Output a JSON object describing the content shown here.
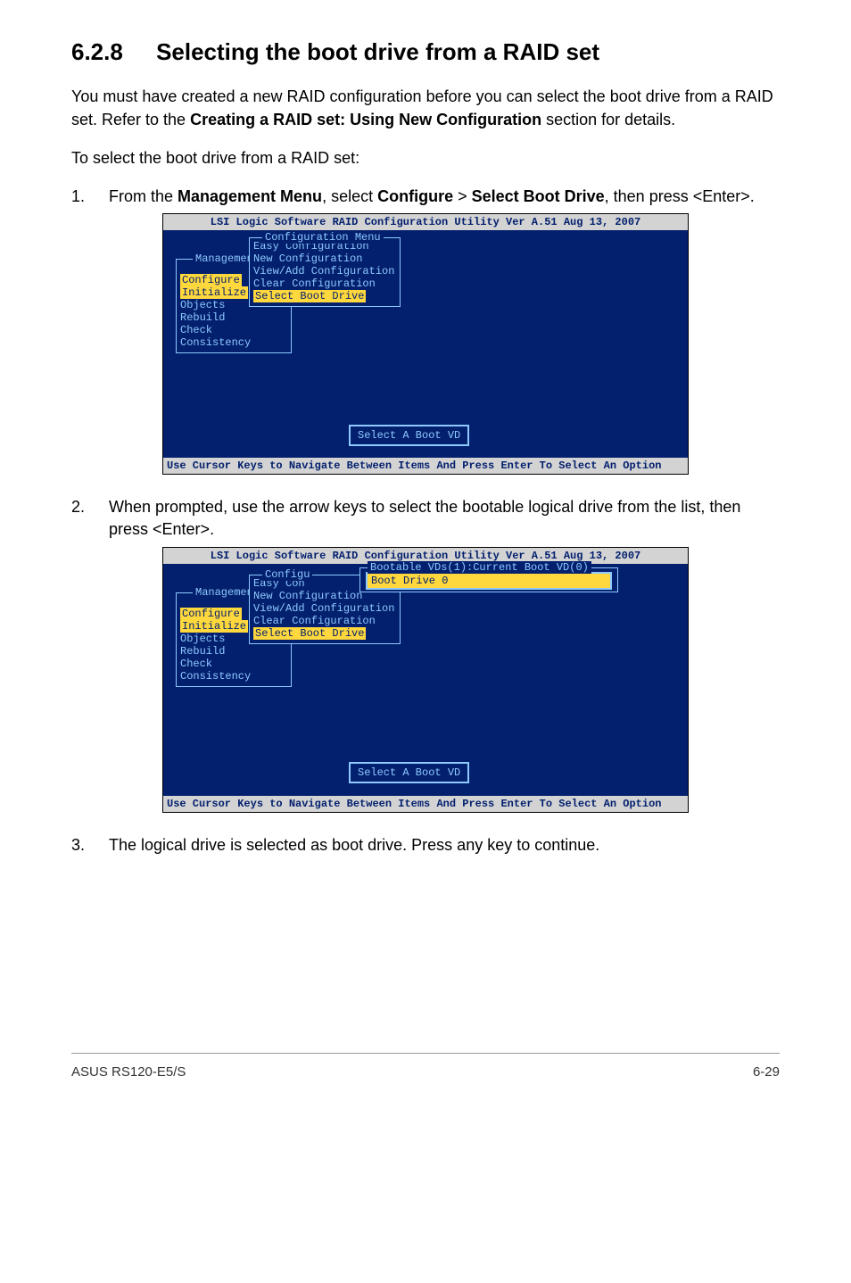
{
  "heading": {
    "number": "6.2.8",
    "title": "Selecting the boot drive from a RAID set"
  },
  "intro": {
    "p1a": "You must have created a new RAID configuration before you can select the boot drive from a RAID set. Refer to the ",
    "p1b": "Creating a RAID set: Using New Configuration",
    "p1c": " section for details.",
    "p2": "To select the boot drive from a RAID set:"
  },
  "steps": {
    "s1": {
      "num": "1.",
      "t1": "From the ",
      "b1": "Management Menu",
      "t2": ", select ",
      "b2": "Configure",
      "t3": " > ",
      "b3": "Select Boot Drive",
      "t4": ", then press <Enter>."
    },
    "s2": {
      "num": "2.",
      "t1": "When prompted, use the arrow keys to select the bootable logical drive from the list, then press <Enter>."
    },
    "s3": {
      "num": "3.",
      "t1": "The logical drive is selected as boot drive. Press any key to continue."
    }
  },
  "bios": {
    "header": "LSI Logic Software RAID Configuration Utility Ver A.51 Aug 13, 2007",
    "footer": "Use Cursor Keys to Navigate Between Items And Press Enter To Select An Option",
    "mgmt_label": "Management",
    "mgmt_items": [
      "Configure",
      "Initialize",
      "Objects",
      "Rebuild",
      "Check Consistency"
    ],
    "cfg_label": "Configuration Menu",
    "cfg_label_short": "Configu",
    "easy_short": "Easy Con",
    "cfg_items": [
      "Easy Configuration",
      "New Configuration",
      "View/Add Configuration",
      "Clear Configuration",
      "Select Boot Drive"
    ],
    "select_boot_vd": "Select A Boot VD",
    "bootable_label": "Bootable VDs(1):Current Boot VD(0)",
    "boot_drive_0": "Boot Drive 0"
  },
  "footer": {
    "left": "ASUS RS120-E5/S",
    "right": "6-29"
  }
}
